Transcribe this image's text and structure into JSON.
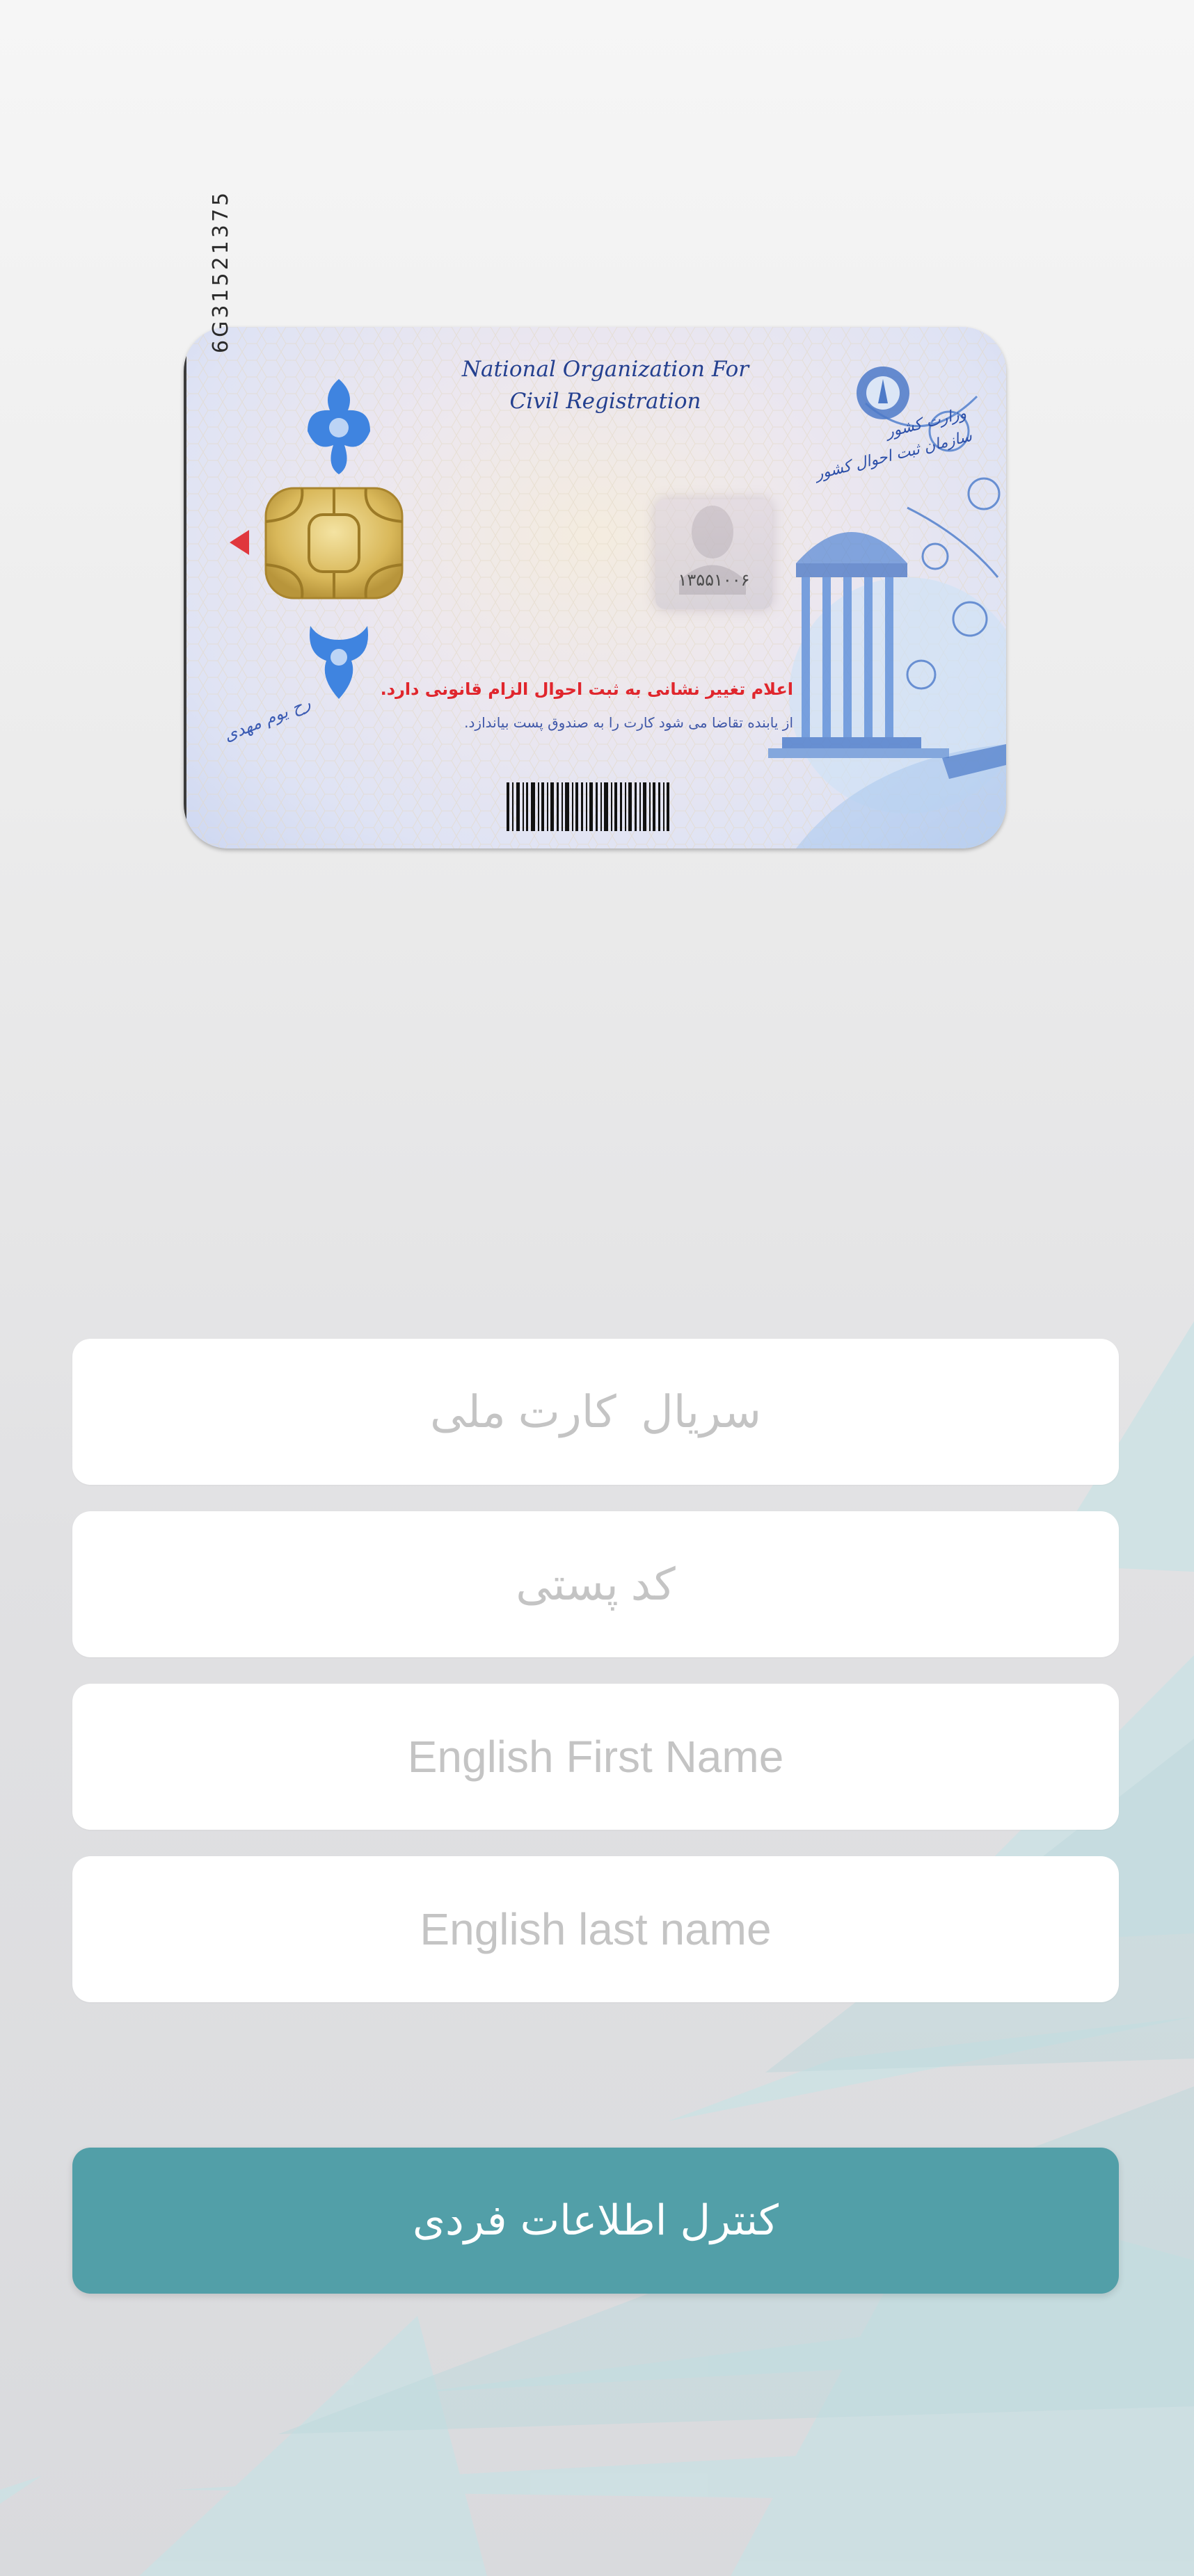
{
  "card": {
    "serial_number": "6G31521375",
    "org_name": "National Organization For Civil Registration",
    "org_line1": "National Organization For",
    "org_line2": "Civil Registration",
    "photo_number": "۱۳۵۵۱۰۰۶",
    "warning_text": "اعلام تغییر نشانی به ثبت احوال الزام قانونی دارد.",
    "note_text": "از یابنده تقاضا می شود کارت را به صندوق پست بیاندازد.",
    "signature_text": "رح یوم مهدی",
    "ministry_line1": "وزارت کشور",
    "ministry_line2": "سازمان ثبت احوال کشور"
  },
  "form": {
    "serial_placeholder": "سریال  کارت ملی",
    "postal_placeholder": "کد پستی",
    "first_name_placeholder": "English First Name",
    "last_name_placeholder": "English last name"
  },
  "submit": {
    "label": "کنترل اطلاعات فردی"
  },
  "colors": {
    "accent": "#529fa8",
    "decor": "#c7dfe3"
  }
}
